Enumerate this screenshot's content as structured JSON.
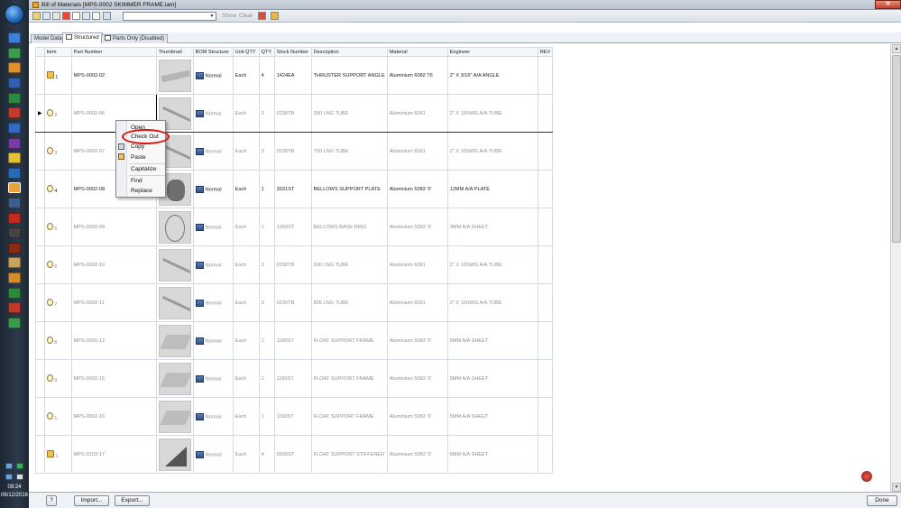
{
  "window": {
    "title": "Bill of Materials [MPS-0002 SKIMMER FRAME.iam]",
    "close_glyph": "✕"
  },
  "toolbar": {
    "show_label": "Show",
    "clear_label": "Clear"
  },
  "tabs": [
    {
      "label": "Model Data"
    },
    {
      "label": "Structured"
    },
    {
      "label": "Parts Only (Disabled)"
    }
  ],
  "columns": [
    "Item",
    "Part Number",
    "Thumbnail",
    "BOM Structure",
    "Unit QTY",
    "QTY",
    "Stock Number",
    "Description",
    "Material",
    "Engineer",
    "REV"
  ],
  "rows": [
    {
      "item": "1",
      "part": "MPS-0002-02",
      "bom": "Normal",
      "unit": "Each",
      "qty": "4",
      "stock": "1424EA",
      "desc": "THRUSTER SUPPORT ANGLE",
      "material": "Aluminium 6082 T6",
      "engineer": "2\" X 3/16\" A/A ANGLE",
      "rev": "",
      "icon": "assembly-icon"
    },
    {
      "item": "2",
      "part": "MPS-0002-06",
      "bom": "Normal",
      "unit": "Each",
      "qty": "3",
      "stock": "0230TB",
      "desc": "300 LNG TUBE",
      "material": "Aluminium 6061",
      "engineer": "2\" X 10SWG A/A TUBE",
      "rev": "",
      "icon": "part-icon"
    },
    {
      "item": "3",
      "part": "MPS-0002-07",
      "bom": "Normal",
      "unit": "Each",
      "qty": "3",
      "stock": "0230TB",
      "desc": "750 LNG TUBE",
      "material": "Aluminium 6061",
      "engineer": "2\" X 10SWG A/A TUBE",
      "rev": "",
      "icon": "part-icon"
    },
    {
      "item": "4",
      "part": "MPS-0002-08",
      "bom": "Normal",
      "unit": "Each",
      "qty": "1",
      "stock": "3931ST",
      "desc": "BELLOWS SUPPORT PLATE",
      "material": "Aluminium 5083 '0'",
      "engineer": "12MM A/A PLATE",
      "rev": "",
      "icon": "part-icon"
    },
    {
      "item": "5",
      "part": "MPS-0002-09",
      "bom": "Normal",
      "unit": "Each",
      "qty": "1",
      "stock": "1269ST",
      "desc": "BELLOWS BASE RING",
      "material": "Aluminium 5083 '0'",
      "engineer": "3MM A/A SHEET",
      "rev": "",
      "icon": "part-icon"
    },
    {
      "item": "6",
      "part": "MPS-0002-10",
      "bom": "Normal",
      "unit": "Each",
      "qty": "3",
      "stock": "0230TB",
      "desc": "500 LNG TUBE",
      "material": "Aluminium 6061",
      "engineer": "2\" X 10SWG A/A TUBE",
      "rev": "",
      "icon": "part-icon"
    },
    {
      "item": "7",
      "part": "MPS-0002-11",
      "bom": "Normal",
      "unit": "Each",
      "qty": "3",
      "stock": "0230TB",
      "desc": "826 LNG TUBE",
      "material": "Aluminium 6061",
      "engineer": "2\" X 10SWG A/A TUBE",
      "rev": "",
      "icon": "part-icon"
    },
    {
      "item": "8",
      "part": "MPS-0002-12",
      "bom": "Normal",
      "unit": "Each",
      "qty": "1",
      "stock": "1190ST",
      "desc": "FLOAT SUPPORT FRAME",
      "material": "Aluminium 5083 '0'",
      "engineer": "5MM A/A SHEET",
      "rev": "",
      "icon": "part-icon"
    },
    {
      "item": "9",
      "part": "MPS-0002-15",
      "bom": "Normal",
      "unit": "Each",
      "qty": "1",
      "stock": "1190ST",
      "desc": "FLOAT SUPPORT FRAME",
      "material": "Aluminium 5083 '0'",
      "engineer": "5MM A/A SHEET",
      "rev": "",
      "icon": "part-icon"
    },
    {
      "item": "1.",
      "part": "MPS-0002-16",
      "bom": "Normal",
      "unit": "Each",
      "qty": "1",
      "stock": "1190ST",
      "desc": "FLOAT SUPPORT FRAME",
      "material": "Aluminium 5083 '0'",
      "engineer": "5MM A/A SHEET",
      "rev": "",
      "icon": "part-icon"
    },
    {
      "item": "1.",
      "part": "MPS-0153-17",
      "bom": "Normal",
      "unit": "Each",
      "qty": "4",
      "stock": "0600ST",
      "desc": "FLOAT SUPPORT STIFFENER",
      "material": "Aluminium 5083 '0'",
      "engineer": "6MM A/A SHEET",
      "rev": "",
      "icon": "assembly-icon"
    }
  ],
  "context_menu": {
    "items": [
      "Open",
      "Check Out",
      "Copy",
      "Paste",
      "Capitalize",
      "Find",
      "Replace"
    ]
  },
  "bottom": {
    "help_label": "?",
    "import_label": "Import...",
    "export_label": "Export...",
    "done_label": "Done"
  },
  "tray": {
    "time": "09:24",
    "date": "06/12/2016"
  },
  "colors": {
    "accent_highlight": "#dd1111",
    "taskbar": "#1d2733",
    "assembly_icon": "#f1c24a"
  }
}
